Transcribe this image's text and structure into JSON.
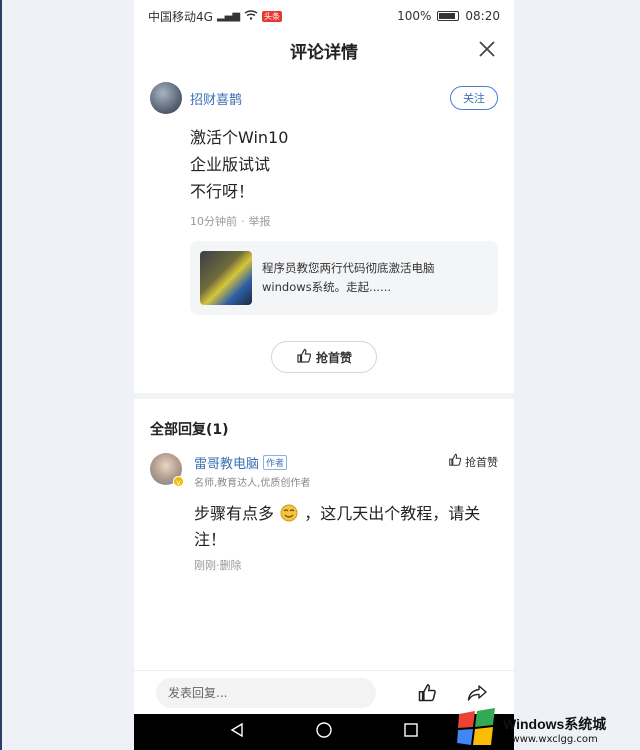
{
  "status_bar": {
    "carrier": "中国移动4G",
    "net_badge": "4G",
    "notify_badge": "头条",
    "battery_pct": "100%",
    "time": "08:20"
  },
  "titlebar": {
    "title": "评论详情",
    "close_icon": "close-icon"
  },
  "comment": {
    "author": "招财喜鹊",
    "follow_label": "关注",
    "lines": [
      "激活个Win10",
      "企业版试试",
      "不行呀！"
    ],
    "time": "10分钟前",
    "report": "举报",
    "article": {
      "line1": "程序员教您两行代码彻底激活电脑",
      "line2": "windows系统。走起......"
    },
    "like_label": "抢首赞"
  },
  "replies": {
    "header": "全部回复(1)",
    "items": [
      {
        "name": "雷哥教电脑",
        "tag": "作者",
        "desc": "名师,教育达人,优质创作者",
        "like_label": "抢首赞",
        "text_before": "步骤有点多",
        "text_after": "，这几天出个教程，请关注！",
        "time": "刚刚",
        "delete": "删除"
      }
    ]
  },
  "bottom_bar": {
    "placeholder": "发表回复..."
  },
  "watermark": {
    "title": "Windows系统城",
    "url": "www.wxclgg.com"
  },
  "colors": {
    "link_blue": "#3a6fb5",
    "badge_gold": "#f5b800"
  }
}
